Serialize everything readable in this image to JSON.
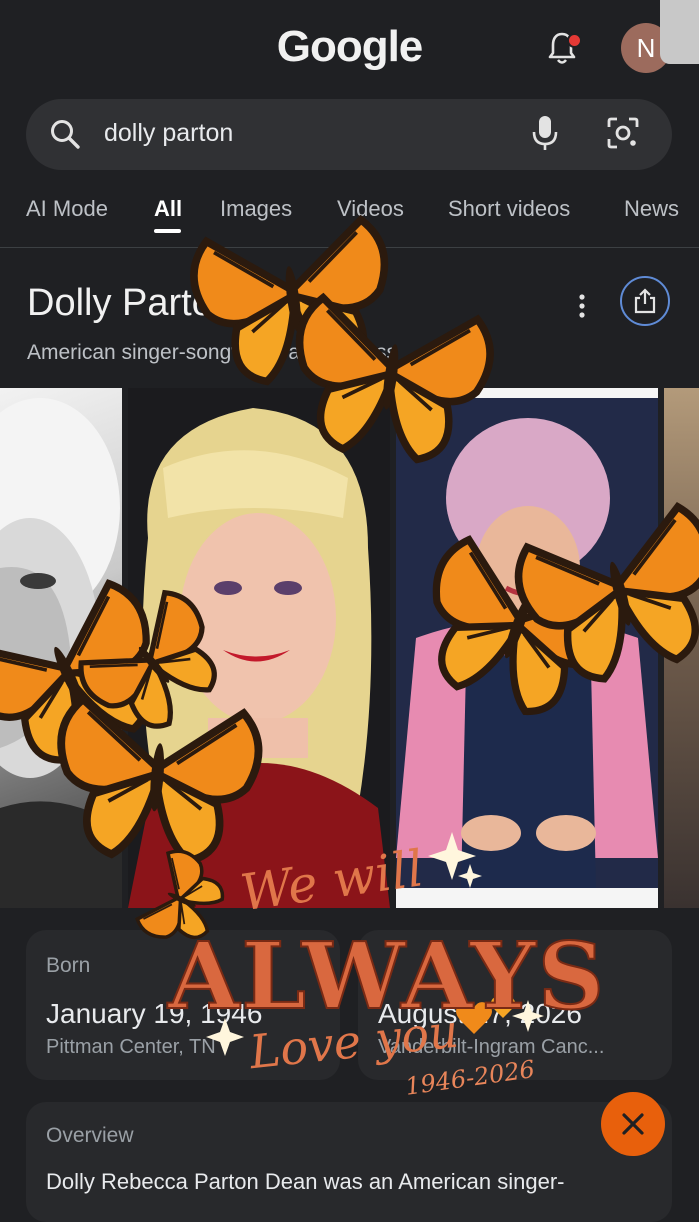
{
  "header": {
    "logo": "Google",
    "avatar_initial": "N",
    "icons": [
      "notification-bell-icon",
      "account-avatar"
    ]
  },
  "search": {
    "query": "dolly parton",
    "icons": [
      "search-icon",
      "microphone-icon",
      "lens-camera-icon"
    ]
  },
  "tabs": [
    {
      "label": "AI Mode",
      "active": false
    },
    {
      "label": "All",
      "active": true
    },
    {
      "label": "Images",
      "active": false
    },
    {
      "label": "Videos",
      "active": false
    },
    {
      "label": "Short videos",
      "active": false
    },
    {
      "label": "News",
      "active": false
    }
  ],
  "knowledge_panel": {
    "title": "Dolly Parton",
    "subtitle": "American singer-songwriter and actress",
    "born_label": "Born",
    "born_date": "January 19, 1946",
    "born_place": "Pittman Center, TN",
    "died_date": "August 27, 2026",
    "died_place": "Vanderbilt-Ingram Canc...",
    "overview_label": "Overview",
    "overview_text": "Dolly Rebecca Parton Dean was an American singer-"
  },
  "overlay": {
    "line1": "We will",
    "line2": "ALWAYS",
    "line3": "Love you",
    "years": "1946-2026",
    "decorations": [
      "monarch-butterfly",
      "sparkle",
      "heart"
    ]
  },
  "colors": {
    "background": "#1f2023",
    "search_bg": "#303134",
    "card_bg": "#28292c",
    "accent_orange": "#e8600c",
    "overlay_text": "#e07a4e"
  }
}
